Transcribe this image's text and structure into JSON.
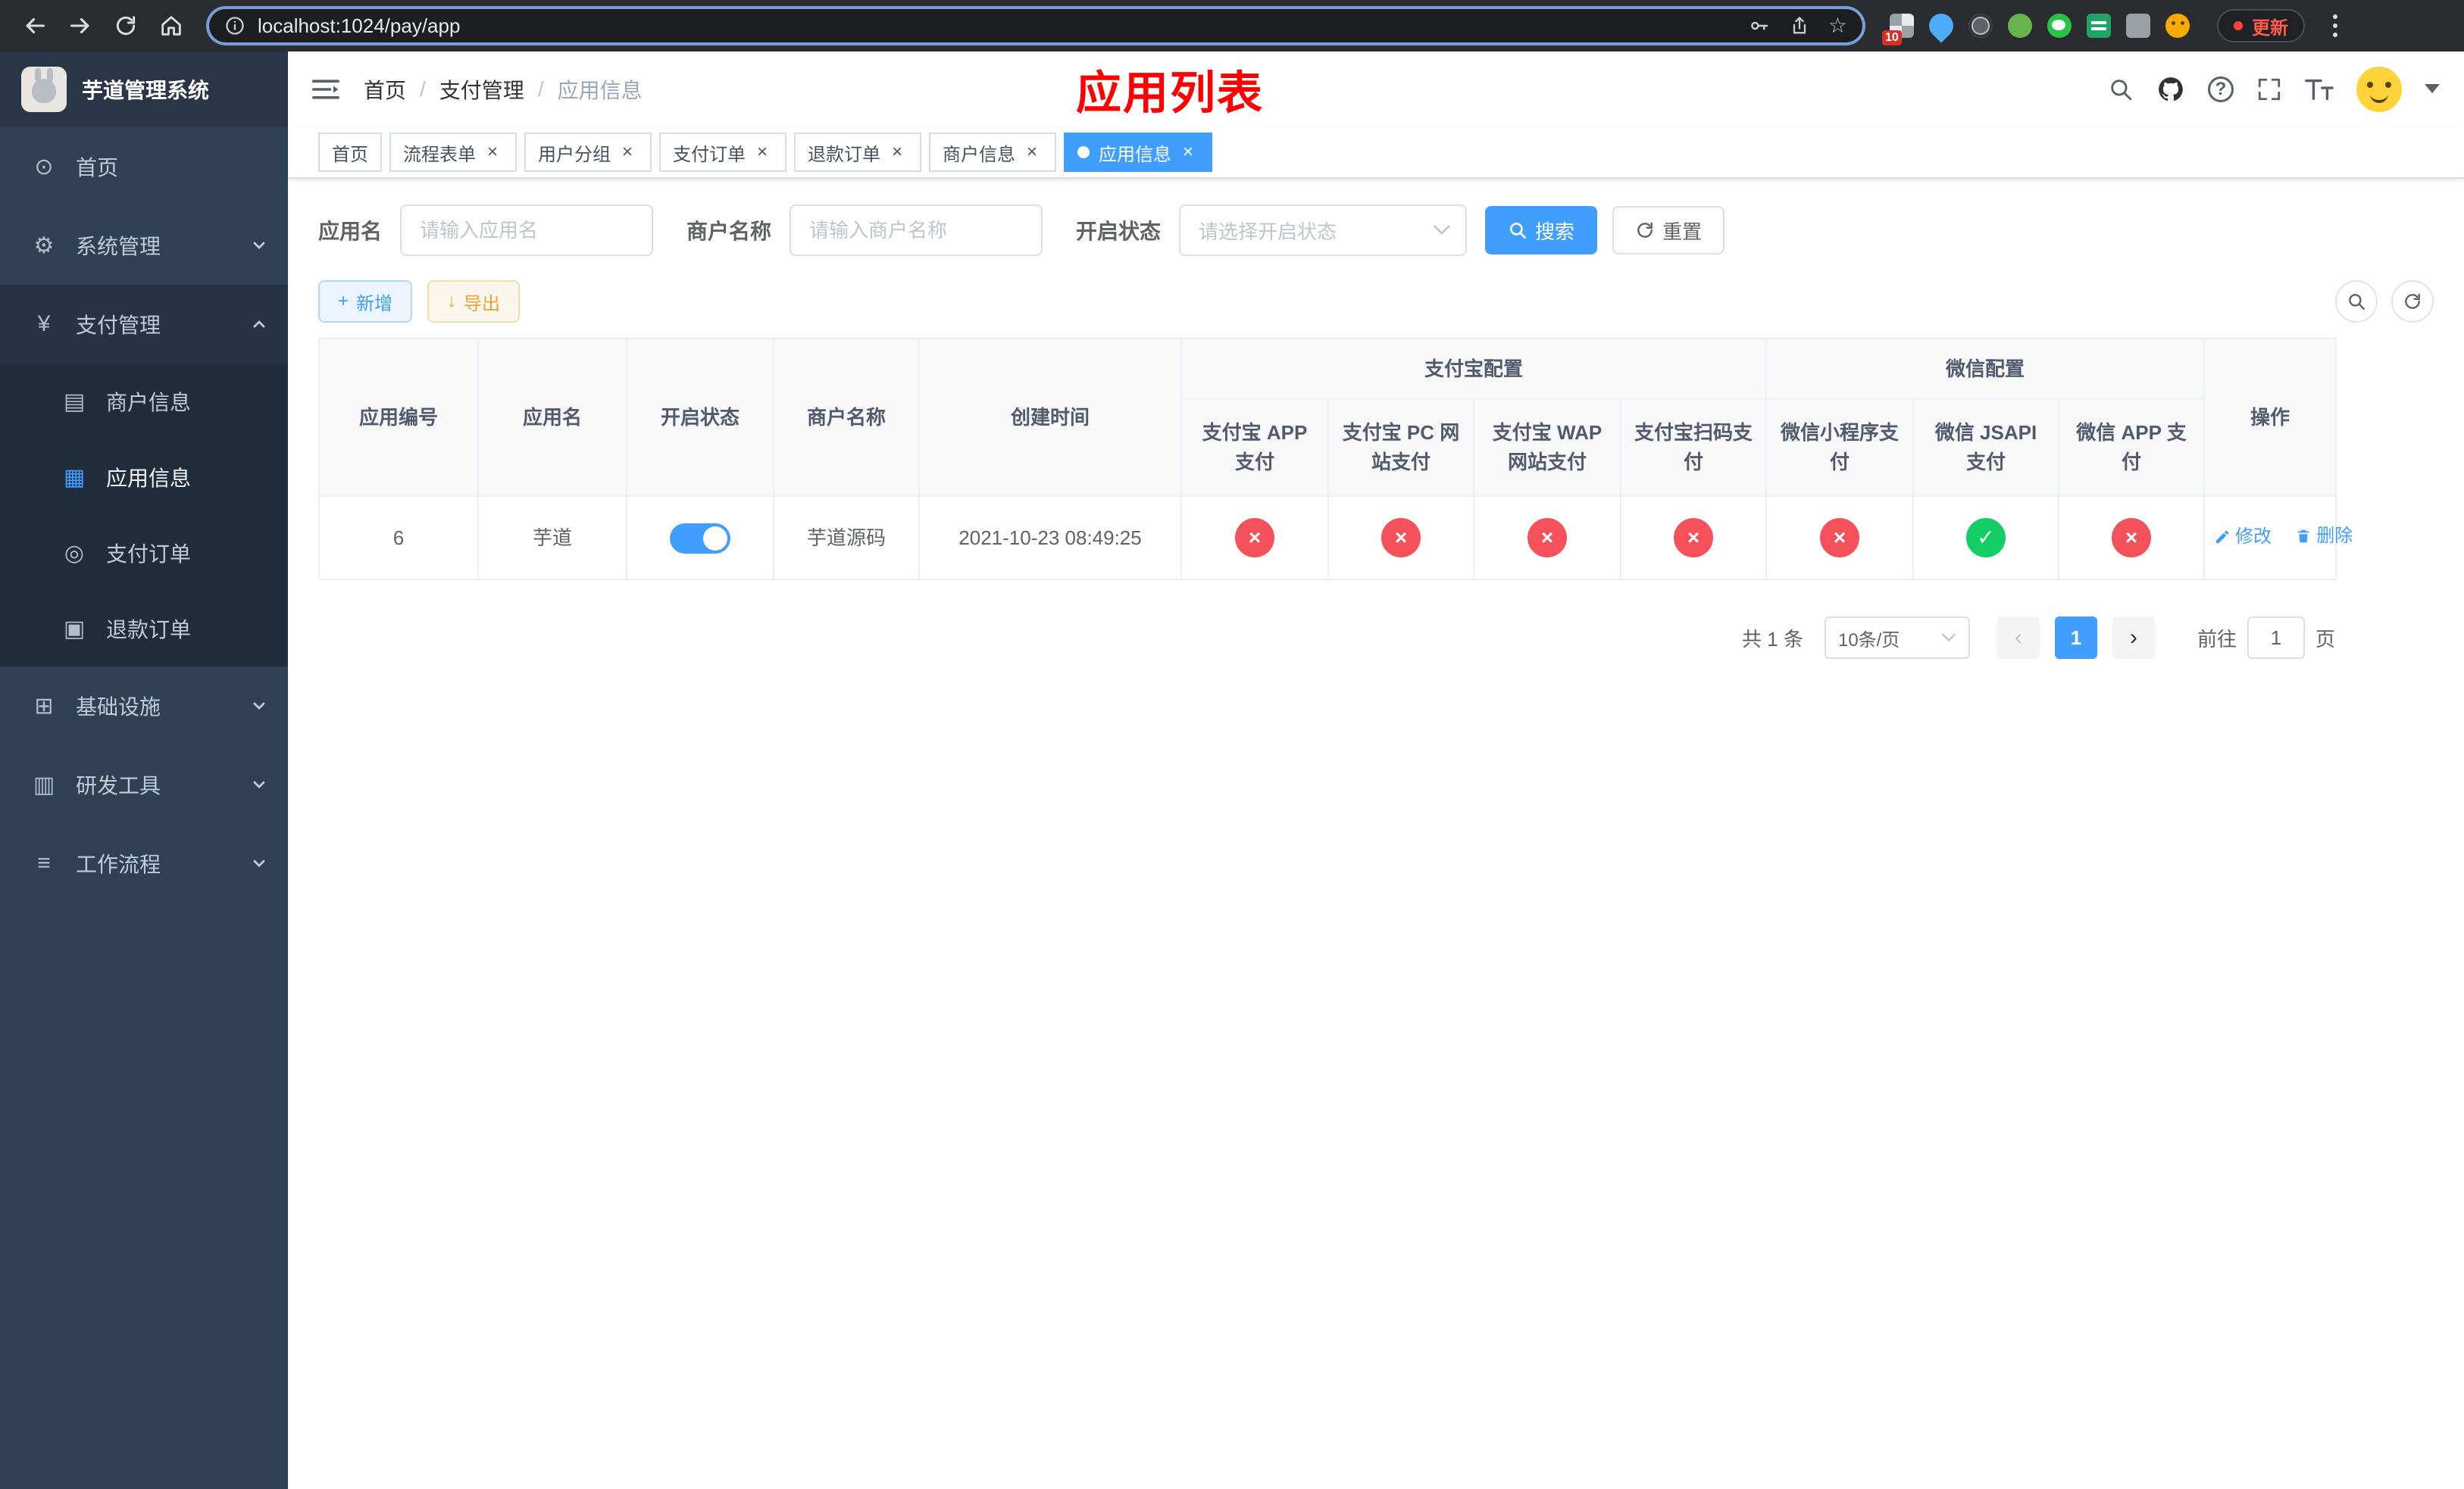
{
  "browser": {
    "url": "localhost:1024/pay/app",
    "update_label": "更新",
    "extension_badge": "10"
  },
  "icons": {
    "close": "×",
    "plus": "+",
    "download": "↓",
    "star": "☆",
    "help": "?",
    "prev": "‹",
    "next": "›",
    "dashboard": "⊙",
    "system": "⚙",
    "payment": "¥",
    "merchant": "▤",
    "app": "▦",
    "order": "◎",
    "refund": "▣",
    "infra": "⊞",
    "devtools": "▥",
    "workflow": "≡"
  },
  "sidebar": {
    "logo_title": "芋道管理系统",
    "items": [
      {
        "label": "首页"
      },
      {
        "label": "系统管理"
      },
      {
        "label": "支付管理"
      },
      {
        "label": "商户信息"
      },
      {
        "label": "应用信息"
      },
      {
        "label": "支付订单"
      },
      {
        "label": "退款订单"
      },
      {
        "label": "基础设施"
      },
      {
        "label": "研发工具"
      },
      {
        "label": "工作流程"
      }
    ]
  },
  "header": {
    "breadcrumb": [
      "首页",
      "支付管理",
      "应用信息"
    ],
    "page_title": "应用列表"
  },
  "tabs": [
    {
      "label": "首页"
    },
    {
      "label": "流程表单"
    },
    {
      "label": "用户分组"
    },
    {
      "label": "支付订单"
    },
    {
      "label": "退款订单"
    },
    {
      "label": "商户信息"
    },
    {
      "label": "应用信息"
    }
  ],
  "filters": {
    "app_name_label": "应用名",
    "app_name_placeholder": "请输入应用名",
    "merchant_label": "商户名称",
    "merchant_placeholder": "请输入商户名称",
    "status_label": "开启状态",
    "status_placeholder": "请选择开启状态",
    "search_label": "搜索",
    "reset_label": "重置"
  },
  "toolbar": {
    "add_label": "新增",
    "export_label": "导出"
  },
  "table": {
    "groups": {
      "alipay": "支付宝配置",
      "wechat": "微信配置"
    },
    "columns": [
      "应用编号",
      "应用名",
      "开启状态",
      "商户名称",
      "创建时间",
      "支付宝 APP 支付",
      "支付宝 PC 网站支付",
      "支付宝 WAP 网站支付",
      "支付宝扫码支付",
      "微信小程序支付",
      "微信 JSAPI 支付",
      "微信 APP 支付",
      "操作"
    ],
    "rows": [
      {
        "id": "6",
        "name": "芋道",
        "enabled": true,
        "merchant": "芋道源码",
        "created": "2021-10-23 08:49:25",
        "configs": [
          {
            "glyph": "×",
            "state": "no"
          },
          {
            "glyph": "×",
            "state": "no"
          },
          {
            "glyph": "×",
            "state": "no"
          },
          {
            "glyph": "×",
            "state": "no"
          },
          {
            "glyph": "×",
            "state": "no"
          },
          {
            "glyph": "✓",
            "state": "yes"
          },
          {
            "glyph": "×",
            "state": "no"
          }
        ],
        "edit_label": "修改",
        "delete_label": "删除"
      }
    ]
  },
  "pagination": {
    "total": "共 1 条",
    "page_size": "10条/页",
    "current_page": "1",
    "goto_label": "前往",
    "goto_value": "1",
    "page_unit": "页"
  },
  "colors": {
    "accent": "#409eff",
    "success": "#13ce66",
    "danger": "#f5515b",
    "warning": "#e6a23c",
    "sidebar_bg": "#304156",
    "title_red": "#ff0000"
  }
}
